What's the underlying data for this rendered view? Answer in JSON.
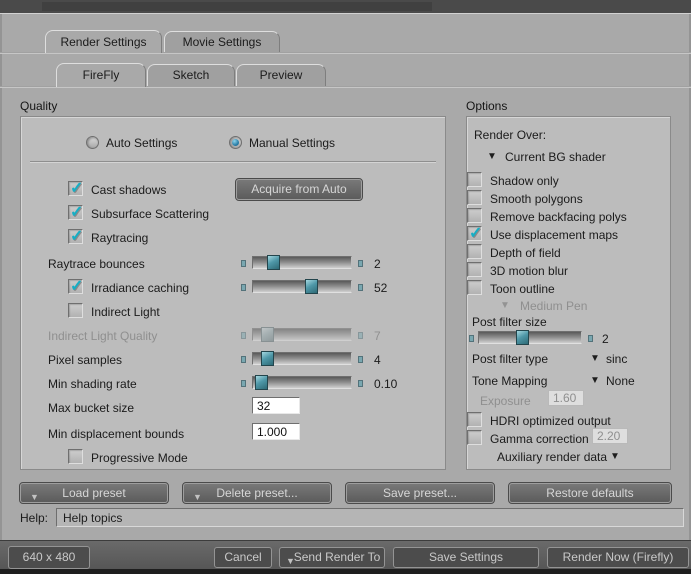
{
  "tabs": {
    "main": [
      {
        "label": "Render Settings"
      },
      {
        "label": "Movie Settings"
      }
    ],
    "sub": [
      {
        "label": "FireFly"
      },
      {
        "label": "Sketch"
      },
      {
        "label": "Preview"
      }
    ]
  },
  "quality": {
    "title": "Quality",
    "auto_settings": "Auto Settings",
    "manual_settings": "Manual Settings",
    "manual_selected": true,
    "acquire_from_auto": "Acquire from Auto",
    "cast_shadows": {
      "label": "Cast shadows",
      "checked": true
    },
    "subsurface": {
      "label": "Subsurface Scattering",
      "checked": true
    },
    "raytracing": {
      "label": "Raytracing",
      "checked": true
    },
    "raytrace_bounces": {
      "label": "Raytrace bounces",
      "value": "2",
      "pct": 14
    },
    "irradiance_caching": {
      "label": "Irradiance caching",
      "checked": true,
      "value": "52",
      "pct": 53
    },
    "indirect_light": {
      "label": "Indirect Light",
      "checked": false
    },
    "indirect_light_quality": {
      "label": "Indirect Light Quality",
      "value": "7",
      "pct": 8,
      "enabled": false
    },
    "pixel_samples": {
      "label": "Pixel samples",
      "value": "4",
      "pct": 8
    },
    "min_shading_rate": {
      "label": "Min shading rate",
      "value": "0.10",
      "pct": 2
    },
    "max_bucket_size": {
      "label": "Max bucket size",
      "value": "32"
    },
    "min_displacement_bounds": {
      "label": "Min displacement bounds",
      "value": "1.000"
    },
    "progressive_mode": {
      "label": "Progressive Mode",
      "checked": false
    }
  },
  "options": {
    "title": "Options",
    "render_over_label": "Render Over:",
    "render_over_value": "Current BG shader",
    "checkboxes": [
      {
        "label": "Shadow only",
        "checked": false
      },
      {
        "label": "Smooth polygons",
        "checked": false
      },
      {
        "label": "Remove backfacing polys",
        "checked": false
      },
      {
        "label": "Use displacement maps",
        "checked": true
      },
      {
        "label": "Depth of field",
        "checked": false
      },
      {
        "label": "3D motion blur",
        "checked": false
      },
      {
        "label": "Toon outline",
        "checked": false
      }
    ],
    "toon_pen": "Medium Pen",
    "post_filter_size": {
      "label": "Post filter size",
      "value": "2",
      "pct": 36
    },
    "post_filter_type": {
      "label": "Post filter type",
      "value": "sinc"
    },
    "tone_mapping": {
      "label": "Tone Mapping",
      "value": "None"
    },
    "exposure": {
      "label": "Exposure",
      "value": "1.60",
      "enabled": false
    },
    "hdri": {
      "label": "HDRI optimized output",
      "checked": false
    },
    "gamma": {
      "label": "Gamma correction",
      "checked": false,
      "value": "2.20"
    },
    "auxiliary": "Auxiliary render data"
  },
  "presets": {
    "load": "Load preset",
    "delete": "Delete preset...",
    "save": "Save preset...",
    "restore": "Restore defaults"
  },
  "help": {
    "label": "Help:",
    "value": "Help topics"
  },
  "footer": {
    "resolution": "640 x 480",
    "cancel": "Cancel",
    "send_render_to": "Send Render To",
    "save_settings": "Save Settings",
    "render_now": "Render Now (Firefly)"
  },
  "colors": {
    "accent_teal": "#17aec4",
    "radio_blue": "#2b7fa8",
    "dialog_bg": "#a9a9a9"
  }
}
